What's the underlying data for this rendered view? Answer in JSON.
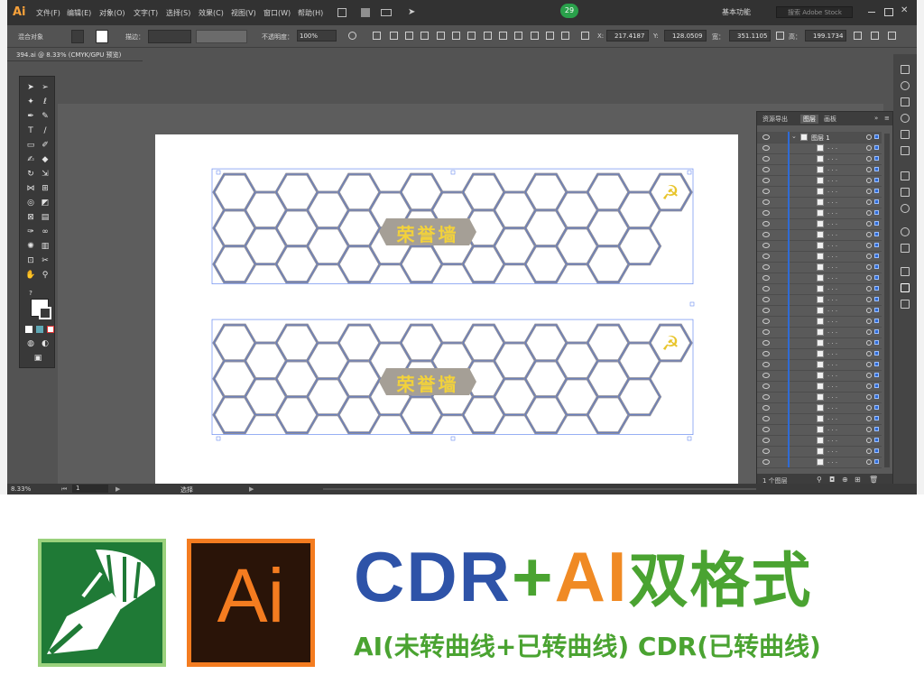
{
  "app": {
    "logo": "Ai",
    "badge": "29",
    "menu": [
      "文件(F)",
      "编辑(E)",
      "对象(O)",
      "文字(T)",
      "选择(S)",
      "效果(C)",
      "视图(V)",
      "窗口(W)",
      "帮助(H)"
    ],
    "workspace_label": "基本功能",
    "search_placeholder": "搜索 Adobe Stock"
  },
  "control_bar": {
    "object_type": "混合对象",
    "stroke_label": "描边：",
    "opacity_label": "不透明度：",
    "opacity_value": "100%",
    "x_label": "X:",
    "x_value": "217.4187",
    "y_label": "Y:",
    "y_value": "128.0509",
    "w_label": "宽：",
    "w_value": "351.1105",
    "h_label": "高：",
    "h_value": "199.1734"
  },
  "document_tab": "394.ai @ 8.33% (CMYK/GPU 预览)",
  "artwork": {
    "title_text": "荣誉墙",
    "colors": {
      "hex_stroke": "#8f8f9c",
      "hex_blue": "#5b79c9",
      "label_fill": "#a59f96",
      "label_text": "#f3d23a",
      "emblem": "#e8c52c"
    }
  },
  "layers_panel": {
    "tabs": [
      "资源导出",
      "图层",
      "画板"
    ],
    "active_tab": "图层",
    "top_layer": "图层 1",
    "footer": "1 个图层"
  },
  "status": {
    "zoom": "8.33%",
    "page": "1",
    "tool": "选择"
  },
  "promo": {
    "cdr_brand_color": "#1f7a36",
    "ai_logo_text": "Ai",
    "headline_part1": "CDR",
    "headline_plus": "+",
    "headline_part2": "AI",
    "headline_part3": "双格式",
    "headline_colors": {
      "cdr": "#2e53a8",
      "plus": "#4aa331",
      "ai": "#f08a24",
      "cn": "#4aa331"
    },
    "subline": "AI(未转曲线+已转曲线) CDR(已转曲线)"
  }
}
